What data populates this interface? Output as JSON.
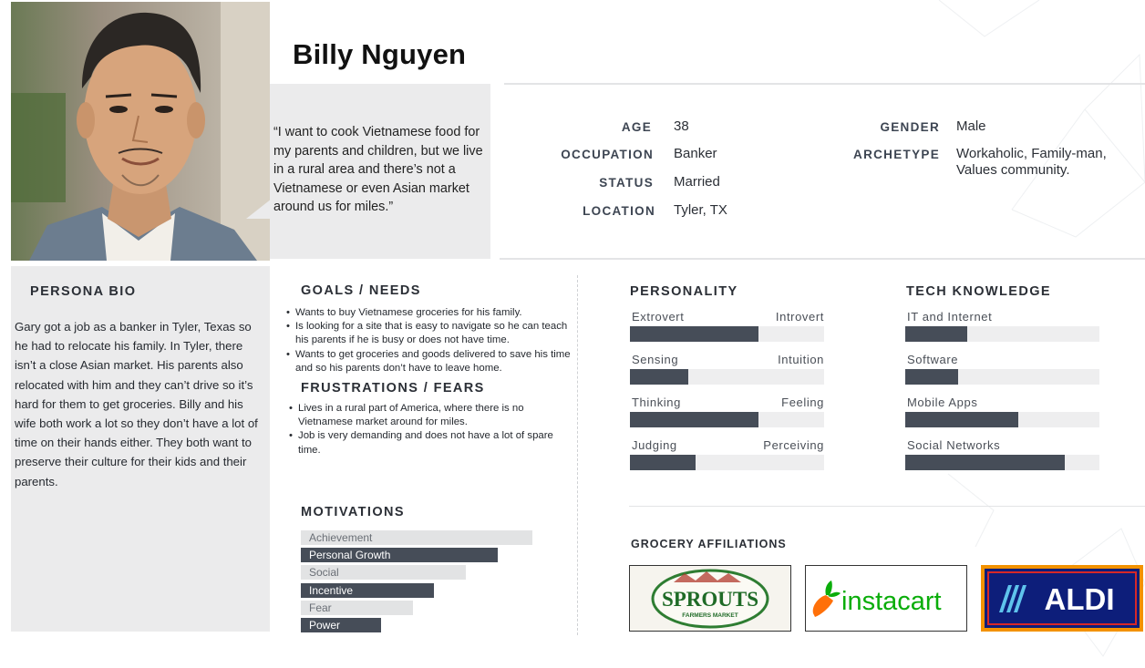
{
  "persona": {
    "name": "Billy Nguyen",
    "quote": "“I want to cook Vietnamese food for my parents and children, but we live in a rural area and there’s not a Vietnamese or even Asian market around us for miles.”"
  },
  "demographics": {
    "age_label": "AGE",
    "age": "38",
    "occupation_label": "OCCUPATION",
    "occupation": "Banker",
    "status_label": "STATUS",
    "status": "Married",
    "location_label": "LOCATION",
    "location": "Tyler, TX",
    "gender_label": "GENDER",
    "gender": "Male",
    "archetype_label": "ARCHETYPE",
    "archetype_line1": "Workaholic, Family-man,",
    "archetype_line2": "Values community."
  },
  "bio": {
    "title": "PERSONA BIO",
    "text": "Gary got a job as a banker in Tyler, Texas so he had to relocate his family. In Tyler, there isn’t a close Asian market. His parents also relocated with him and they can’t drive so it’s hard for them to get groceries. Billy and his wife both work a lot so they don’t have a lot of time on their hands either. They both want to preserve their culture for their kids and their parents."
  },
  "goals": {
    "title": "GOALS / NEEDS",
    "items": [
      "Wants to buy Vietnamese groceries for his family.",
      "Is looking for a site that is easy to navigate so he can teach his parents if he is busy or does not have time.",
      "Wants to get groceries and goods delivered to save his time and so his parents don’t have to leave home."
    ]
  },
  "frustrations": {
    "title": "FRUSTRATIONS / FEARS",
    "items": [
      "Lives in a rural part of America, where there is no Vietnamese market around for miles.",
      "Job is very demanding and does not have a lot of spare time."
    ]
  },
  "motivations": {
    "title": "MOTIVATIONS",
    "items": [
      {
        "label": "Achievement",
        "value": 0.87,
        "dark": false
      },
      {
        "label": "Personal Growth",
        "value": 0.74,
        "dark": true
      },
      {
        "label": "Social",
        "value": 0.62,
        "dark": false
      },
      {
        "label": "Incentive",
        "value": 0.5,
        "dark": true
      },
      {
        "label": "Fear",
        "value": 0.42,
        "dark": false
      },
      {
        "label": "Power",
        "value": 0.3,
        "dark": true
      }
    ]
  },
  "personality": {
    "title": "PERSONALITY",
    "scales": [
      {
        "left": "Extrovert",
        "right": "Introvert",
        "value": 0.66
      },
      {
        "left": "Sensing",
        "right": "Intuition",
        "value": 0.3
      },
      {
        "left": "Thinking",
        "right": "Feeling",
        "value": 0.66
      },
      {
        "left": "Judging",
        "right": "Perceiving",
        "value": 0.34
      }
    ]
  },
  "tech": {
    "title": "TECH KNOWLEDGE",
    "scales": [
      {
        "label": "IT and Internet",
        "value": 0.32
      },
      {
        "label": "Software",
        "value": 0.27
      },
      {
        "label": "Mobile Apps",
        "value": 0.58
      },
      {
        "label": "Social Networks",
        "value": 0.82
      }
    ]
  },
  "affiliations": {
    "title": "GROCERY AFFILIATIONS",
    "sprouts_text": "SPROUTS",
    "sprouts_sub": "FARMERS MARKET",
    "instacart_text": "instacart",
    "aldi_text": "ALDI"
  },
  "colors": {
    "dark_bar": "#464d58",
    "light_bar": "#e2e3e4",
    "panel": "#ebebec",
    "instacart_green": "#0aad0a",
    "instacart_orange": "#ff7009",
    "aldi_navy": "#0d1e7a",
    "aldi_orange": "#f39200",
    "sprouts_green": "#2e7d32"
  }
}
